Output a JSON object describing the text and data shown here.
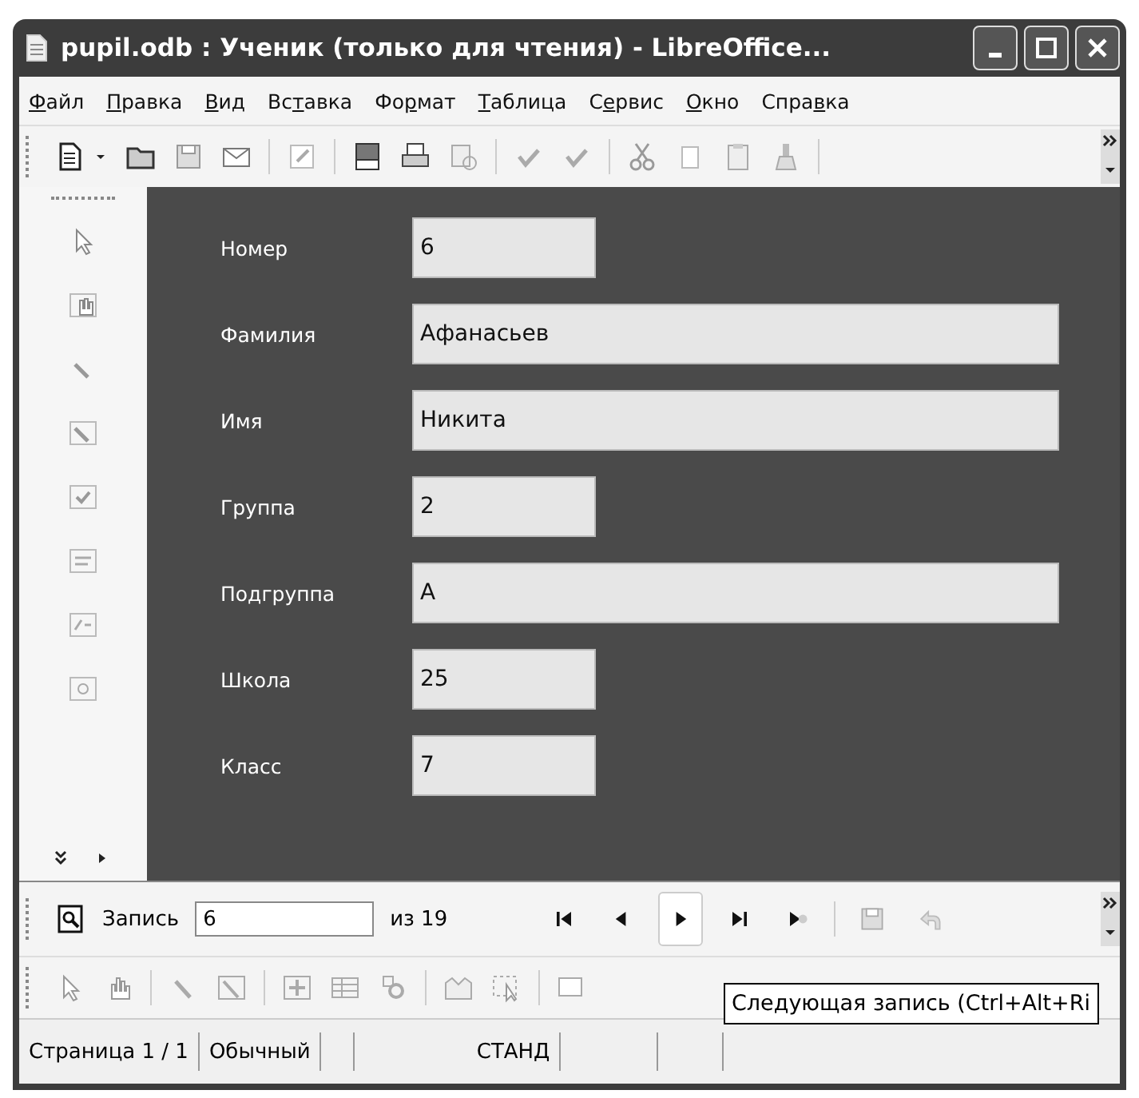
{
  "window": {
    "title": "pupil.odb : Ученик (только для чтения) - LibreOffice..."
  },
  "menu": [
    {
      "label": "Файл"
    },
    {
      "label": "Правка"
    },
    {
      "label": "Вид"
    },
    {
      "label": "Вставка"
    },
    {
      "label": "Формат"
    },
    {
      "label": "Таблица"
    },
    {
      "label": "Сервис"
    },
    {
      "label": "Окно"
    },
    {
      "label": "Справка"
    }
  ],
  "form": {
    "fields": [
      {
        "label": "Номер",
        "value": "6",
        "kind": "short"
      },
      {
        "label": "Фамилия",
        "value": "Афанасьев",
        "kind": "long"
      },
      {
        "label": "Имя",
        "value": "Никита",
        "kind": "long"
      },
      {
        "label": "Группа",
        "value": "2",
        "kind": "short"
      },
      {
        "label": "Подгруппа",
        "value": "А",
        "kind": "long"
      },
      {
        "label": "Школа",
        "value": "25",
        "kind": "short"
      },
      {
        "label": "Класс",
        "value": "7",
        "kind": "short"
      }
    ]
  },
  "navigation": {
    "record_label": "Запись",
    "record_value": "6",
    "total": "из 19"
  },
  "tooltip": "Следующая запись (Ctrl+Alt+Ri",
  "status_bar": [
    "Страница  1 / 1",
    "Обычный",
    "СТАНД"
  ]
}
